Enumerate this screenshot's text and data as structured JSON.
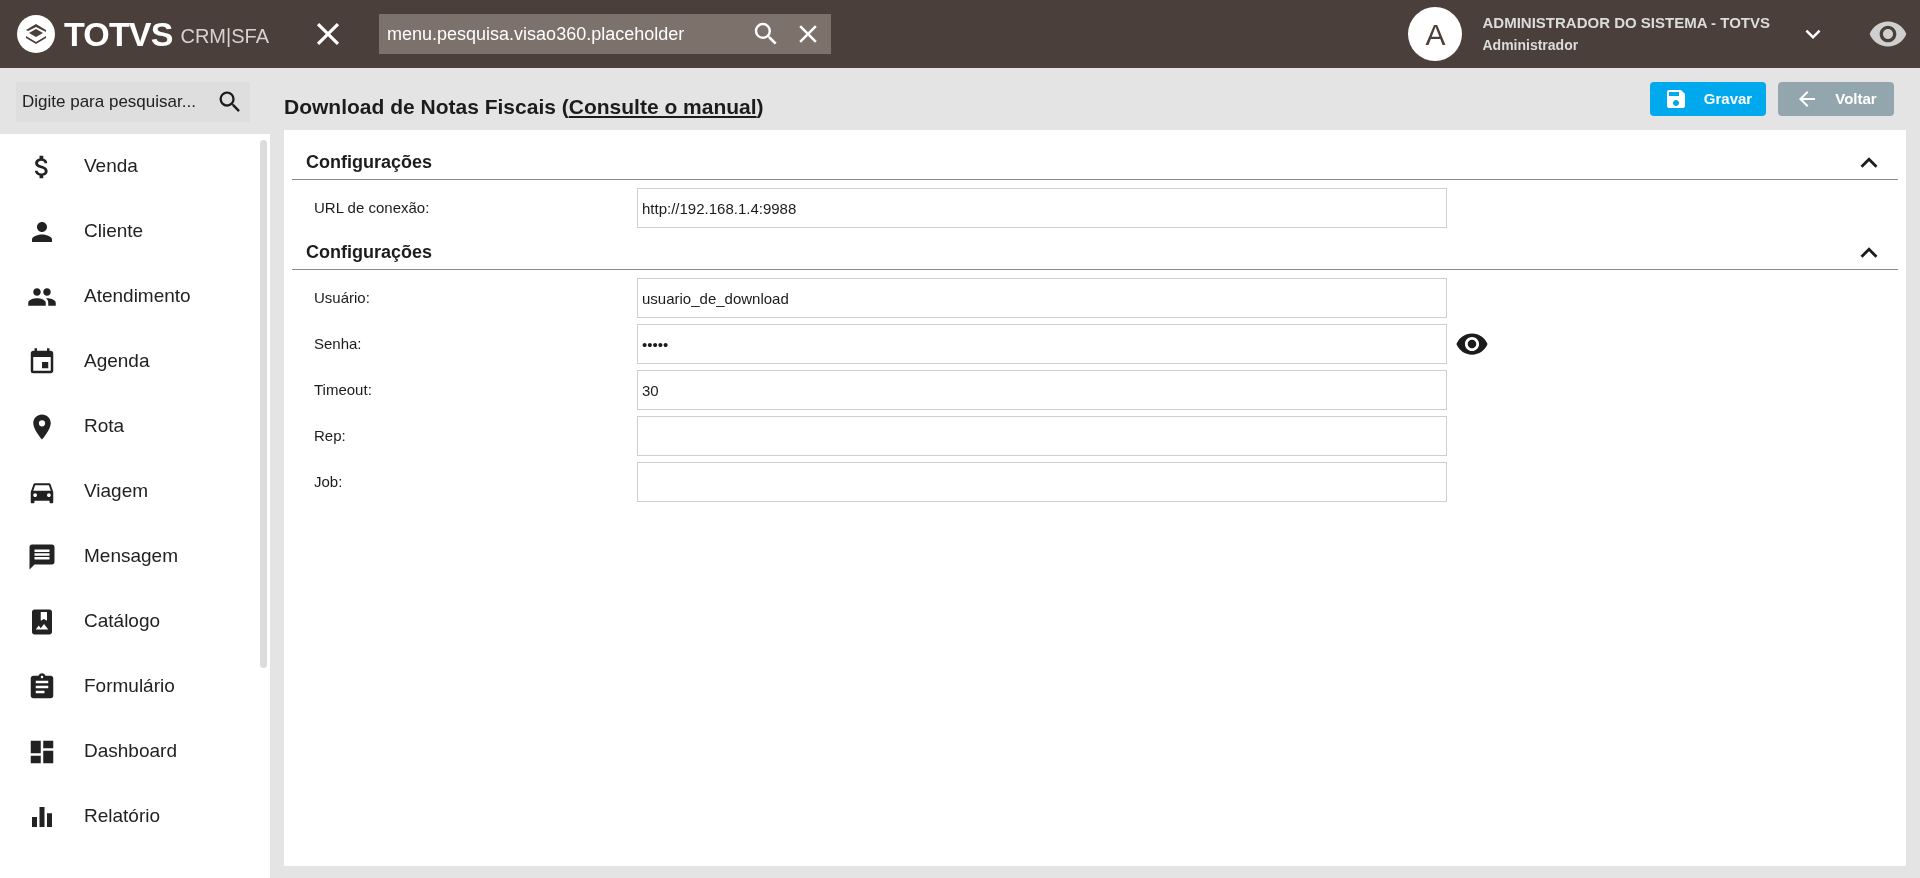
{
  "header": {
    "brand": "TOTVS",
    "product": "CRM|SFA",
    "search": {
      "placeholder": "menu.pesquisa.visao360.placeholder"
    },
    "user": {
      "initial": "A",
      "name": "ADMINISTRADOR DO SISTEMA - TOTVS",
      "role": "Administrador"
    }
  },
  "sidebar": {
    "search": {
      "placeholder": "Digite para pesquisar..."
    },
    "items": [
      {
        "label": "Venda"
      },
      {
        "label": "Cliente"
      },
      {
        "label": "Atendimento"
      },
      {
        "label": "Agenda"
      },
      {
        "label": "Rota"
      },
      {
        "label": "Viagem"
      },
      {
        "label": "Mensagem"
      },
      {
        "label": "Catálogo"
      },
      {
        "label": "Formulário"
      },
      {
        "label": "Dashboard"
      },
      {
        "label": "Relatório"
      }
    ]
  },
  "page": {
    "title": "Download de Notas Fiscais",
    "link_open": "(",
    "link": "Consulte o manual",
    "link_close": ")",
    "buttons": [
      {
        "label": "Gravar",
        "kind": "primary"
      },
      {
        "label": "Voltar",
        "kind": "back"
      }
    ]
  },
  "sections": [
    {
      "title": "Configurações",
      "expanded": true,
      "fields": [
        {
          "label": "URL de conexão:",
          "value": "http://192.168.1.4:9988",
          "kind": "text"
        }
      ]
    },
    {
      "title": "Configurações",
      "expanded": true,
      "fields": [
        {
          "label": "Usuário:",
          "value": "usuario_de_download",
          "kind": "text"
        },
        {
          "label": "Senha:",
          "value": "•••••",
          "kind": "password"
        },
        {
          "label": "Timeout:",
          "value": "30",
          "kind": "text"
        },
        {
          "label": "Rep:",
          "kind": "text"
        },
        {
          "label": "Job:",
          "kind": "text"
        }
      ]
    }
  ]
}
